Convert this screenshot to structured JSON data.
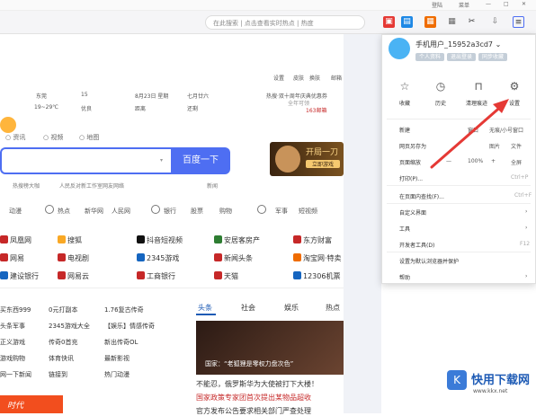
{
  "titlebar": {
    "buttons": [
      "登陆",
      "菜单",
      "—",
      "□",
      "✕"
    ]
  },
  "address": {
    "placeholder": "在此搜索 | 点击查看实时热点 | 热度"
  },
  "top_nav": [
    "设置",
    "皮肤",
    "换肤",
    "邮箱"
  ],
  "weather": {
    "city": "东莞",
    "temp": "19~29℃",
    "aqi_label": "15",
    "aqi_quality": "优良",
    "date": "8月23日 星期",
    "lunar": "七月廿六",
    "festival": "距离",
    "dist_days": "还剩",
    "promo_title": "热搜·双十周年庆典优惠券",
    "promo_sub": "全年可领",
    "mail_label": "163邮箱"
  },
  "search": {
    "radio": [
      "资讯",
      "视频",
      "地图"
    ],
    "button_label": "百度一下",
    "hotwords": [
      "热搜榜大咖",
      "人民反对新工作室网友网络",
      "新闻"
    ]
  },
  "ad": {
    "title": "开局一刀",
    "sub": "立即游戏"
  },
  "categories": [
    "动漫",
    "热点",
    "新华网",
    "人民网",
    "银行",
    "股票",
    "购物",
    "军事",
    "短视频"
  ],
  "sites": [
    {
      "name": "凤凰网",
      "color": "#c62828"
    },
    {
      "name": "搜狐",
      "color": "#f9a825"
    },
    {
      "name": "抖音短视频",
      "color": "#111111"
    },
    {
      "name": "安居客房产",
      "color": "#2e7d32"
    },
    {
      "name": "东方财富",
      "color": "#c62828"
    },
    {
      "name": "网易",
      "color": "#c62828"
    },
    {
      "name": "电视剧",
      "color": "#c62828"
    },
    {
      "name": "2345游戏",
      "color": "#1565c0"
    },
    {
      "name": "新闻头条",
      "color": "#c62828"
    },
    {
      "name": "淘宝网·特卖",
      "color": "#ef6c00"
    },
    {
      "name": "建设银行",
      "color": "#1565c0"
    },
    {
      "name": "网易云",
      "color": "#c62828"
    },
    {
      "name": "工商银行",
      "color": "#c62828"
    },
    {
      "name": "天猫",
      "color": "#c62828"
    },
    {
      "name": "12306机票",
      "color": "#1565c0"
    }
  ],
  "links": [
    [
      "买东西999",
      "0元打副本",
      "1.76复古传奇"
    ],
    [
      "头条军事",
      "2345游戏大全",
      "【娱乐】情感传奇"
    ],
    [
      "正义游戏",
      "传奇0首充",
      "新出传奇OL"
    ],
    [
      "游戏购物",
      "体育快讯",
      "最新影视"
    ],
    [
      "网一下新闻",
      "链接到",
      "热门动漫"
    ]
  ],
  "news": {
    "tabs": [
      "头条",
      "社会",
      "娱乐",
      "热点"
    ],
    "image_caption": "国家：“老狐狸是零权力盘次色”",
    "lines": [
      {
        "text": "不能忍，俄罗斯华为大使被打下大楼！",
        "color": "#333333"
      },
      {
        "text": "国家政策专家团首次提出某物品超收",
        "color": "#c62828"
      },
      {
        "text": "官方发布公告要求相关部门严查处理",
        "color": "#333333"
      }
    ]
  },
  "red_banner": "时代",
  "menu": {
    "username": "手机用户_15952a3cd7",
    "badges": [
      "个人资料",
      "退出登录",
      "同步收藏"
    ],
    "quick": [
      {
        "label": "收藏",
        "icon": "star-icon"
      },
      {
        "label": "历史",
        "icon": "clock-icon"
      },
      {
        "label": "清理痕迹",
        "icon": "broom-icon"
      },
      {
        "label": "设置",
        "icon": "gear-icon"
      }
    ],
    "items": [
      {
        "label": "新建",
        "values": [
          "窗口",
          "无痕/小号窗口"
        ]
      },
      {
        "label": "网页另存为",
        "values": [
          "图片",
          "文件"
        ]
      },
      {
        "label": "页面缩放",
        "values": [
          "—",
          "100%",
          "+",
          "全屏"
        ]
      },
      {
        "label": "打印(P)...",
        "values": [
          "Ctrl+P"
        ]
      },
      {
        "label": "在页面内查找(F)...",
        "values": [
          "Ctrl+F"
        ]
      },
      {
        "label": "自定义界面",
        "values": [
          "›"
        ]
      },
      {
        "label": "工具",
        "values": [
          "›"
        ]
      },
      {
        "label": "开发者工具(D)",
        "values": [
          "F12"
        ]
      },
      {
        "label": "设置为默认浏览器并保护",
        "values": []
      },
      {
        "label": "帮助",
        "values": [
          "›"
        ]
      }
    ]
  },
  "watermark": {
    "title": "快用下载网",
    "url": "www.kkx.net"
  }
}
